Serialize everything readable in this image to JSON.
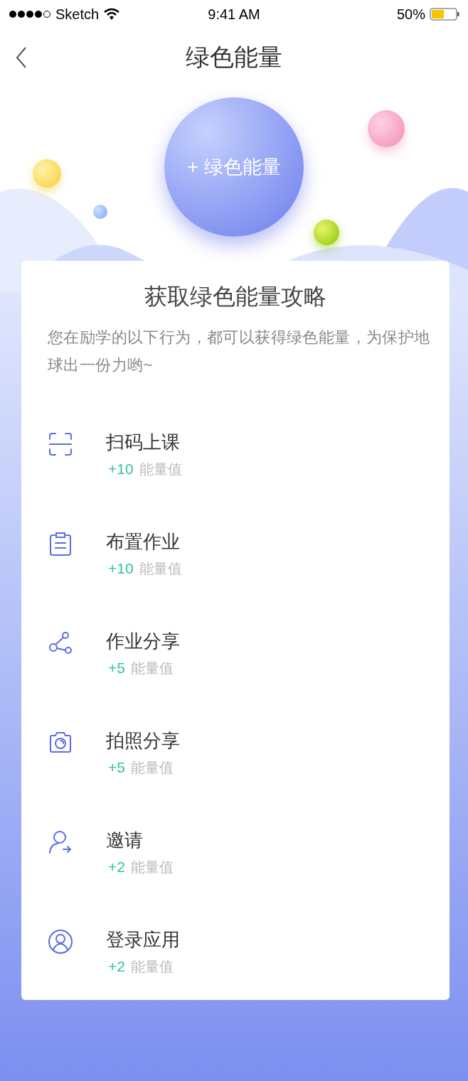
{
  "status_bar": {
    "carrier": "Sketch",
    "time": "9:41 AM",
    "battery": "50%"
  },
  "nav": {
    "title": "绿色能量"
  },
  "hero": {
    "button": "+ 绿色能量"
  },
  "card": {
    "title": "获取绿色能量攻略",
    "description": "您在励学的以下行为，都可以获得绿色能量，为保护地球出一份力哟~",
    "items": [
      {
        "kind": "scan",
        "title": "扫码上课",
        "points": "+10",
        "unit": "能量值"
      },
      {
        "kind": "clipboard",
        "title": "布置作业",
        "points": "+10",
        "unit": "能量值"
      },
      {
        "kind": "share",
        "title": "作业分享",
        "points": "+5",
        "unit": "能量值"
      },
      {
        "kind": "camera",
        "title": "拍照分享",
        "points": "+5",
        "unit": "能量值"
      },
      {
        "kind": "invite",
        "title": "邀请",
        "points": "+2",
        "unit": "能量值"
      },
      {
        "kind": "user",
        "title": "登录应用",
        "points": "+2",
        "unit": "能量值"
      }
    ]
  }
}
